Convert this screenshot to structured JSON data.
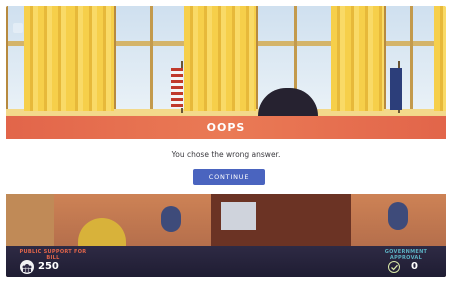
{
  "modal": {
    "title": "OOPS",
    "message": "You chose the wrong answer.",
    "continue_label": "CONTINUE"
  },
  "stats": {
    "public_support_label": "PUBLIC SUPPORT FOR BILL",
    "public_support_value": "250",
    "government_approval_label": "GOVERNMENT APPROVAL",
    "government_approval_value": "0"
  },
  "icons": {
    "menu": "menu-icon",
    "support": "crowd-icon",
    "approval": "checkmark-icon"
  },
  "colors": {
    "header_accent": "#e2654a",
    "button": "#4a64bf",
    "bottom_bar": "#2e2a44",
    "approval_label": "#5bb0c2"
  }
}
